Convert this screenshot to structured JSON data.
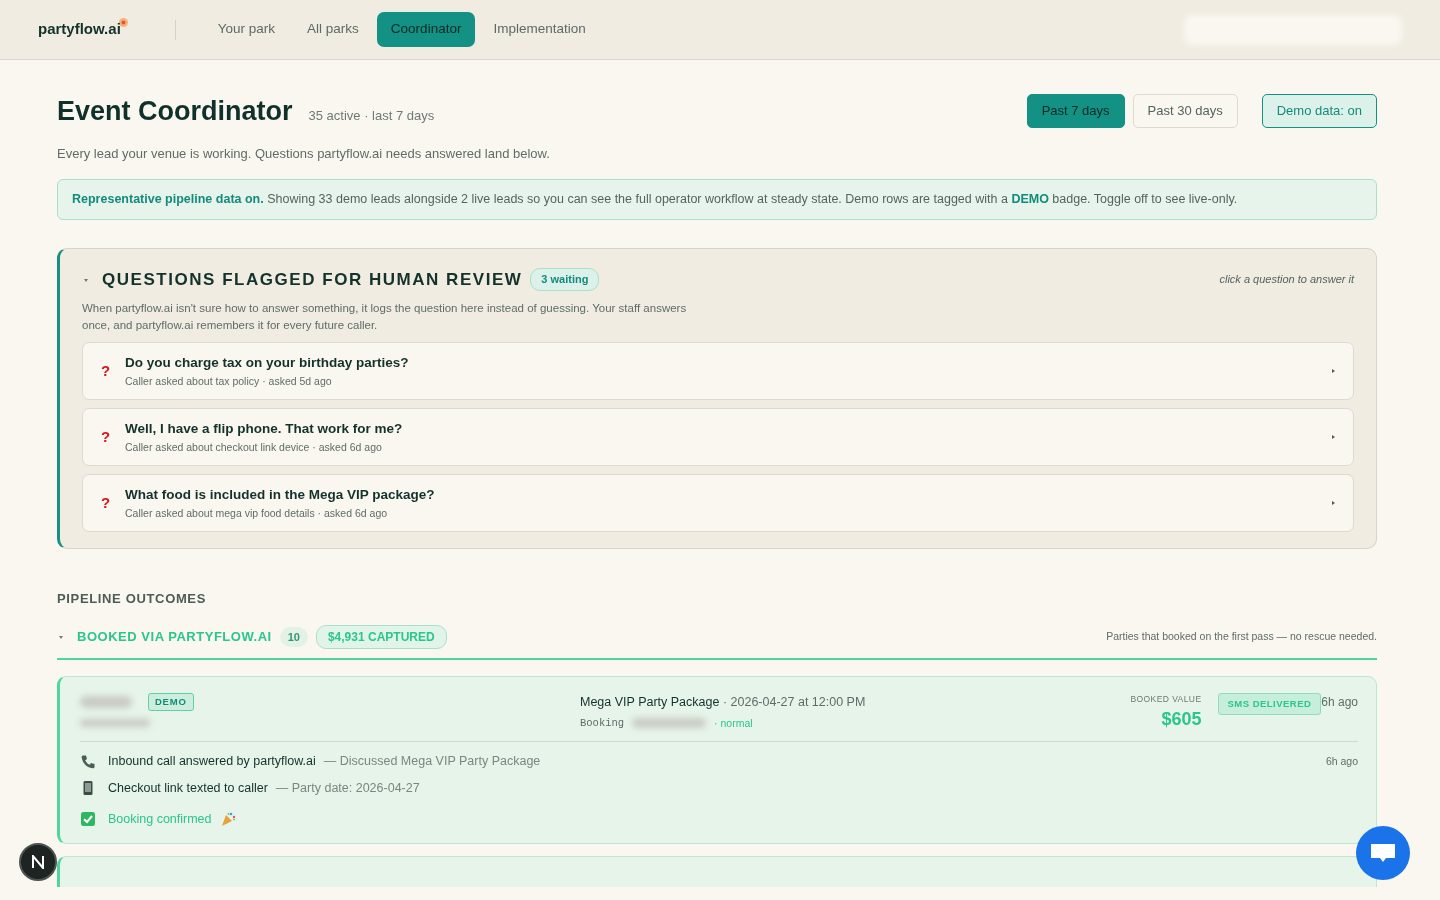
{
  "nav": {
    "logo": "partyflow.ai",
    "tabs": [
      {
        "label": "Your park",
        "selected": false
      },
      {
        "label": "All parks",
        "selected": false
      },
      {
        "label": "Coordinator",
        "selected": true
      },
      {
        "label": "Implementation",
        "selected": false
      }
    ]
  },
  "header": {
    "title": "Event Coordinator",
    "subtitle": "35 active · last 7 days",
    "description": "Every lead your venue is working. Questions partyflow.ai needs answered land below.",
    "ranges": [
      {
        "label": "Past 7 days",
        "selected": true
      },
      {
        "label": "Past 30 days",
        "selected": false
      }
    ],
    "demo_toggle": {
      "label": "Demo data: on",
      "on": true
    }
  },
  "notice": "**Representative pipeline data on.** Showing 33 demo leads alongside 2 live leads so you can see the full operator workflow at steady state. Demo rows are tagged with a **DEMO** badge. Toggle off to see live-only.",
  "review": {
    "title": "QUESTIONS FLAGGED FOR HUMAN REVIEW",
    "badge": "3 waiting",
    "expanded": true,
    "hint": "click a question to answer it",
    "description": "When partyflow.ai isn't sure how to answer something, it logs the question here instead of guessing. Your staff answers once, and partyflow.ai remembers it for every future caller.",
    "questions": [
      {
        "mark": "?",
        "question": "Do you charge tax on your birthday parties?",
        "meta": "Caller asked about tax policy · asked 5d ago",
        "expanded": false
      },
      {
        "mark": "?",
        "question": "Well, I have a flip phone. That work for me?",
        "meta": "Caller asked about checkout link device · asked 6d ago",
        "expanded": false
      },
      {
        "mark": "?",
        "question": "What food is included in the Mega VIP package?",
        "meta": "Caller asked about mega vip food details · asked 6d ago",
        "expanded": false
      }
    ]
  },
  "pipeline": {
    "heading": "PIPELINE OUTCOMES",
    "group": {
      "title": "BOOKED VIA PARTYFLOW.AI",
      "count": "10",
      "captured": "$4,931 CAPTURED",
      "note": "Parties that booked on the first pass — no rescue needed.",
      "expanded": true
    },
    "leads": [
      {
        "badge": "DEMO",
        "package": "Mega VIP Party Package",
        "when": " · 2026-04-27 at 12:00 PM",
        "booking_label": "Booking",
        "priority": "· normal",
        "value_label": "BOOKED VALUE",
        "value": "$605",
        "status": "SMS DELIVERED",
        "time": "6h ago",
        "events": [
          {
            "kind": "call",
            "title": "Inbound call answered by partyflow.ai",
            "detail": "— Discussed Mega VIP Party Package",
            "time": "6h ago"
          },
          {
            "kind": "sms",
            "title": "Checkout link texted to caller",
            "detail": "— Party date: 2026-04-27"
          },
          {
            "kind": "confirmed",
            "title": "Booking confirmed"
          }
        ]
      },
      {
        "kind": "cut"
      }
    ]
  }
}
